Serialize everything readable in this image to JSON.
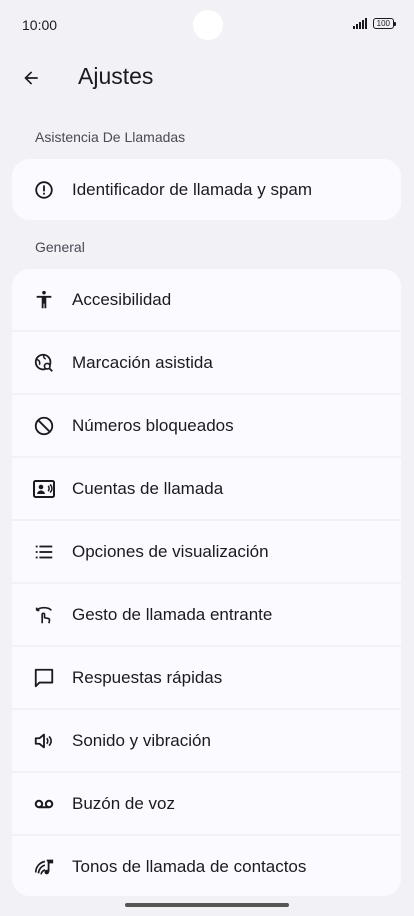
{
  "status_bar": {
    "time": "10:00",
    "battery": "100"
  },
  "app_bar": {
    "title": "Ajustes"
  },
  "sections": [
    {
      "header": "Asistencia De Llamadas",
      "items": [
        {
          "label": "Identificador de llamada y spam",
          "icon": "alert-circle-icon"
        }
      ]
    },
    {
      "header": "General",
      "items": [
        {
          "label": "Accesibilidad",
          "icon": "accessibility-icon"
        },
        {
          "label": "Marcación asistida",
          "icon": "globe-search-icon"
        },
        {
          "label": "Números bloqueados",
          "icon": "block-icon"
        },
        {
          "label": "Cuentas de llamada",
          "icon": "account-card-icon"
        },
        {
          "label": "Opciones de visualización",
          "icon": "list-icon"
        },
        {
          "label": "Gesto de llamada entrante",
          "icon": "swipe-gesture-icon"
        },
        {
          "label": "Respuestas rápidas",
          "icon": "chat-bubble-icon"
        },
        {
          "label": "Sonido y vibración",
          "icon": "speaker-icon"
        },
        {
          "label": "Buzón de voz",
          "icon": "voicemail-icon"
        },
        {
          "label": "Tonos de llamada de contactos",
          "icon": "contact-ringtone-icon"
        }
      ]
    }
  ],
  "colors": {
    "background": "#f2f1f6",
    "card": "#fbfbff",
    "text": "#1b1b1f",
    "secondary_text": "#4a4a55"
  }
}
